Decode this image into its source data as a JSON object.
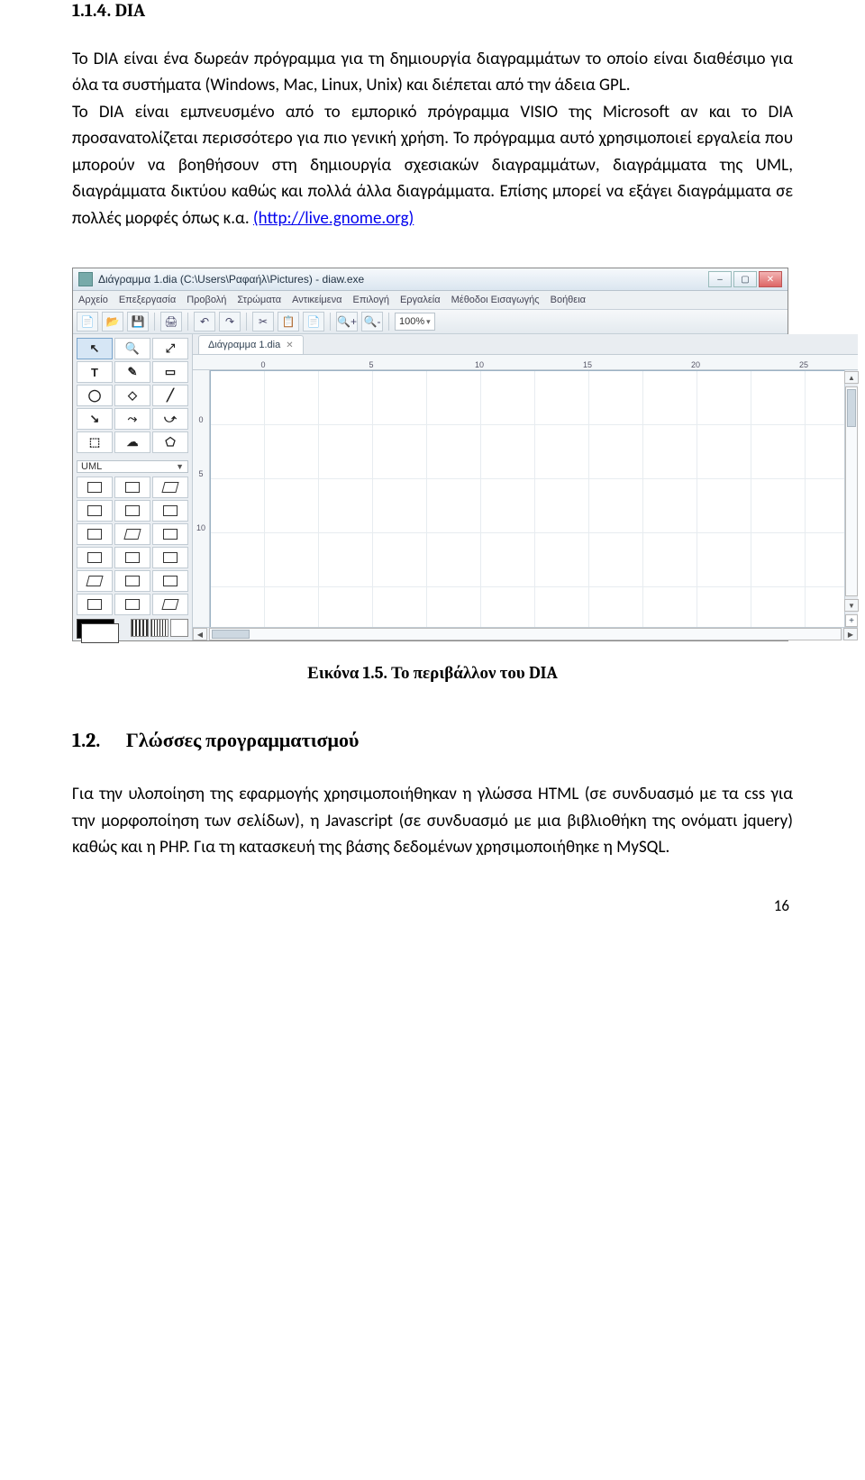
{
  "section": {
    "number": "1.1.4.",
    "title": "DIA"
  },
  "para1": "Το DIA είναι ένα δωρεάν πρόγραμμα για τη δημιουργία διαγραμμάτων το οποίο είναι διαθέσιμο για όλα τα συστήματα (Windows, Mac, Linux, Unix) και διέπεται από την άδεια GPL.",
  "para2_a": "Το DIA είναι εμπνευσμένο από το εμπορικό πρόγραμμα VISIO της Microsoft αν και το DIA προσανατολίζεται περισσότερο για πιο γενική χρήση. Το πρόγραμμα αυτό χρησιμοποιεί εργαλεία που μπορούν να βοηθήσουν στη δημιουργία σχεσιακών διαγραμμάτων, διαγράμματα της UML, διαγράμματα δικτύου καθώς και πολλά άλλα διαγράμματα. Επίσης μπορεί να εξάγει διαγράμματα σε πολλές μορφές όπως κ.α. ",
  "link_text": "(http://live.gnome.org)",
  "caption": "Εικόνα 1.5. Το περιβάλλον του DIA",
  "h2": {
    "num": "1.2.",
    "title": "Γλώσσες προγραμματισμού"
  },
  "para3": "Για την υλοποίηση της εφαρμογής χρησιμοποιήθηκαν η γλώσσα HTML (σε συνδυασμό με τα css για την μορφοποίηση των σελίδων), η Javascript (σε συνδυασμό με μια βιβλιοθήκη της ονόματι jquery) καθώς και η PHP. Για τη κατασκευή της βάσης δεδομένων χρησιμοποιήθηκε η MySQL.",
  "page_number": "16",
  "dia": {
    "title": "Διάγραμμα 1.dia (C:\\Users\\Ραφαήλ\\Pictures) - diaw.exe",
    "menu": [
      "Αρχείο",
      "Επεξεργασία",
      "Προβολή",
      "Στρώματα",
      "Αντικείμενα",
      "Επιλογή",
      "Εργαλεία",
      "Μέθοδοι Εισαγωγής",
      "Βοήθεια"
    ],
    "zoom": "100%",
    "tab": "Διάγραμμα 1.dia",
    "category": "UML",
    "ruler_marks": [
      "0",
      "5",
      "10",
      "15",
      "20",
      "25"
    ],
    "ruler_v": [
      "0",
      "5",
      "10"
    ],
    "tool_glyphs": [
      "↖",
      "🔍",
      "⤢",
      "T",
      "✎",
      "▭",
      "◯",
      "◇",
      "╱",
      "↘",
      "⤳",
      "⤻",
      "⬚",
      "☁",
      "⬠"
    ],
    "shape_count": 18,
    "toolbar_glyphs": [
      "📄",
      "📂",
      "💾",
      "|",
      "🖨",
      "|",
      "↶",
      "↷",
      "|",
      "✂",
      "📋",
      "📄",
      "|",
      "🔍+",
      "🔍-"
    ]
  }
}
